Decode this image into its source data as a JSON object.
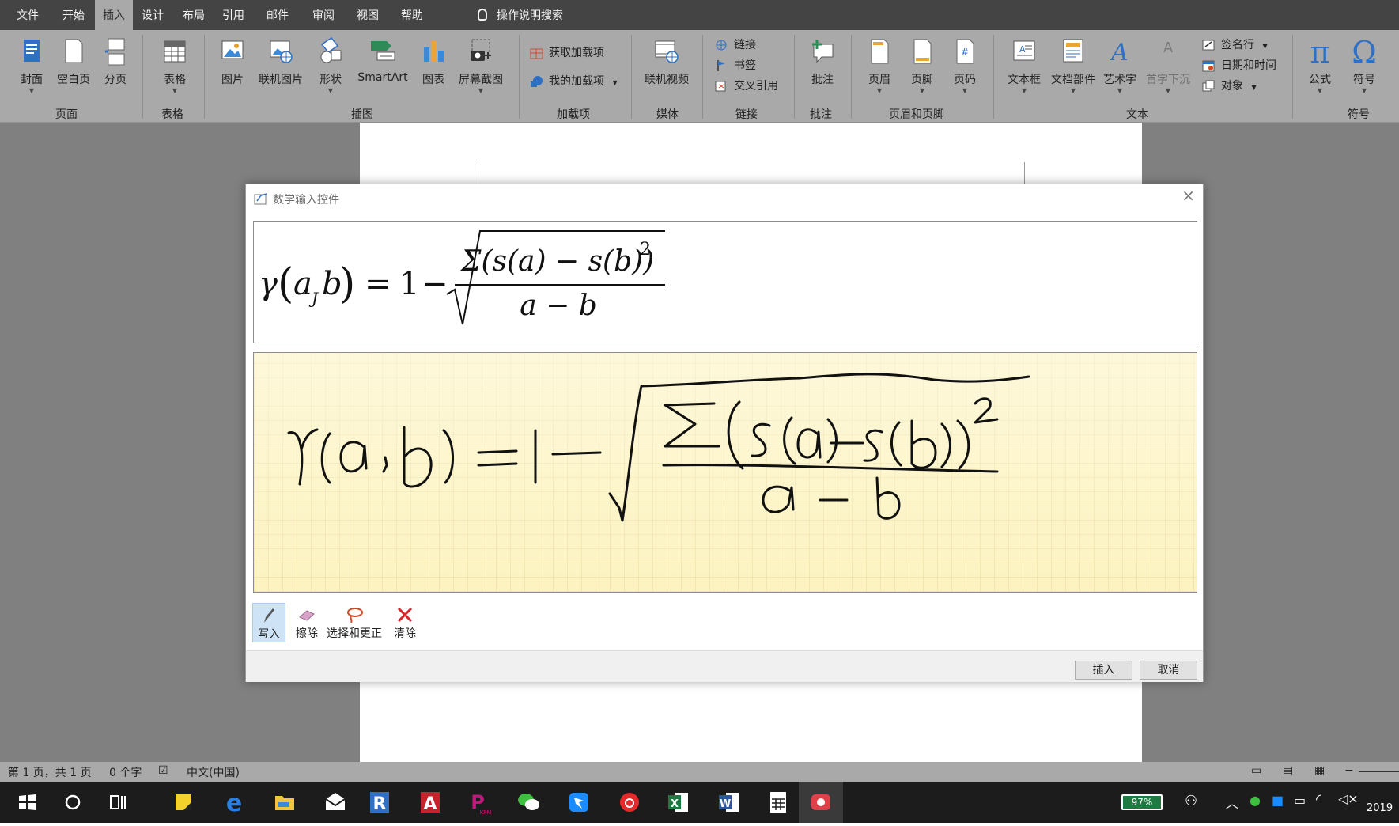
{
  "menubar": {
    "tabs": [
      "文件",
      "开始",
      "插入",
      "设计",
      "布局",
      "引用",
      "邮件",
      "审阅",
      "视图",
      "帮助"
    ],
    "active_tab": "插入",
    "tell_me": "操作说明搜索"
  },
  "ribbon": {
    "page_group": {
      "label": "页面",
      "cover": "封面",
      "blank": "空白页",
      "break": "分页"
    },
    "table_group": {
      "label": "表格",
      "table": "表格"
    },
    "illus_group": {
      "label": "插图",
      "picture": "图片",
      "online_picture": "联机图片",
      "shapes": "形状",
      "smartart": "SmartArt",
      "chart": "图表",
      "screenshot": "屏幕截图"
    },
    "addins_group": {
      "label": "加载项",
      "get": "获取加载项",
      "my": "我的加载项"
    },
    "media_group": {
      "label": "媒体",
      "video": "联机视频"
    },
    "links_group": {
      "label": "链接",
      "link": "链接",
      "bookmark": "书签",
      "crossref": "交叉引用"
    },
    "comments_group": {
      "label": "批注",
      "comment": "批注"
    },
    "hf_group": {
      "label": "页眉和页脚",
      "header": "页眉",
      "footer": "页脚",
      "pagenum": "页码"
    },
    "text_group": {
      "label": "文本",
      "textbox": "文本框",
      "quickparts": "文档部件",
      "wordart": "艺术字",
      "dropcap": "首字下沉",
      "signature": "签名行",
      "datetime": "日期和时间",
      "object": "对象"
    },
    "symbols_group": {
      "label": "符号",
      "equation": "公式",
      "symbol": "符号"
    },
    "equation_glyph": "π",
    "symbol_glyph": "Ω"
  },
  "dialog": {
    "title": "数学输入控件",
    "close_glyph": "×",
    "formula": {
      "lhs_gamma": "γ",
      "lhs_args": "a",
      "lhs_sub": "J",
      "lhs_b": "b",
      "eq": "=",
      "one": "1",
      "minus": "−",
      "numerator": "Σ(s(a) − s(b))",
      "exponent": "2",
      "denominator": "a − b"
    },
    "tools": [
      "写入",
      "擦除",
      "选择和更正",
      "清除"
    ],
    "selected_tool": "写入",
    "insert_button": "插入",
    "cancel_button": "取消"
  },
  "statusbar": {
    "page": "第 1 页，共 1 页",
    "words": "0 个字",
    "language": "中文(中国)"
  },
  "taskbar": {
    "battery": "97%",
    "clock": "2019"
  }
}
